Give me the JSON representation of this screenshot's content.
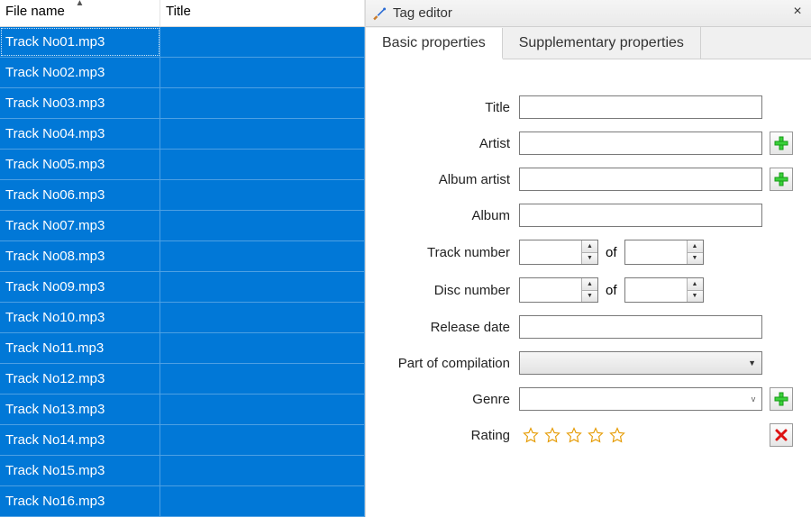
{
  "table": {
    "columns": {
      "filename": "File name",
      "title": "Title"
    },
    "rows": [
      {
        "filename": "Track No01.mp3",
        "title": ""
      },
      {
        "filename": "Track No02.mp3",
        "title": ""
      },
      {
        "filename": "Track No03.mp3",
        "title": ""
      },
      {
        "filename": "Track No04.mp3",
        "title": ""
      },
      {
        "filename": "Track No05.mp3",
        "title": ""
      },
      {
        "filename": "Track No06.mp3",
        "title": ""
      },
      {
        "filename": "Track No07.mp3",
        "title": ""
      },
      {
        "filename": "Track No08.mp3",
        "title": ""
      },
      {
        "filename": "Track No09.mp3",
        "title": ""
      },
      {
        "filename": "Track No10.mp3",
        "title": ""
      },
      {
        "filename": "Track No11.mp3",
        "title": ""
      },
      {
        "filename": "Track No12.mp3",
        "title": ""
      },
      {
        "filename": "Track No13.mp3",
        "title": ""
      },
      {
        "filename": "Track No14.mp3",
        "title": ""
      },
      {
        "filename": "Track No15.mp3",
        "title": ""
      },
      {
        "filename": "Track No16.mp3",
        "title": ""
      }
    ]
  },
  "panel": {
    "title": "Tag editor"
  },
  "tabs": {
    "basic": "Basic properties",
    "supp": "Supplementary properties"
  },
  "form": {
    "title_label": "Title",
    "title_value": "",
    "artist_label": "Artist",
    "artist_value": "",
    "album_artist_label": "Album artist",
    "album_artist_value": "",
    "album_label": "Album",
    "album_value": "",
    "track_number_label": "Track number",
    "track_no": "",
    "track_total": "",
    "disc_number_label": "Disc number",
    "disc_no": "",
    "disc_total": "",
    "of_word": "of",
    "release_date_label": "Release date",
    "release_date_value": "",
    "compilation_label": "Part of compilation",
    "compilation_value": "",
    "genre_label": "Genre",
    "genre_value": "",
    "rating_label": "Rating",
    "rating_value": 0
  }
}
